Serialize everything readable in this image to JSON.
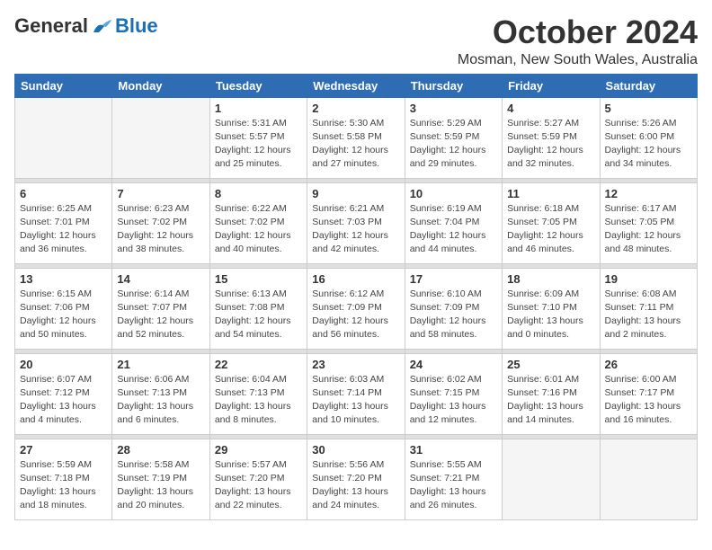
{
  "header": {
    "logo_general": "General",
    "logo_blue": "Blue",
    "month_title": "October 2024",
    "location": "Mosman, New South Wales, Australia"
  },
  "weekdays": [
    "Sunday",
    "Monday",
    "Tuesday",
    "Wednesday",
    "Thursday",
    "Friday",
    "Saturday"
  ],
  "weeks": [
    [
      {
        "day": "",
        "info": ""
      },
      {
        "day": "",
        "info": ""
      },
      {
        "day": "1",
        "info": "Sunrise: 5:31 AM\nSunset: 5:57 PM\nDaylight: 12 hours\nand 25 minutes."
      },
      {
        "day": "2",
        "info": "Sunrise: 5:30 AM\nSunset: 5:58 PM\nDaylight: 12 hours\nand 27 minutes."
      },
      {
        "day": "3",
        "info": "Sunrise: 5:29 AM\nSunset: 5:59 PM\nDaylight: 12 hours\nand 29 minutes."
      },
      {
        "day": "4",
        "info": "Sunrise: 5:27 AM\nSunset: 5:59 PM\nDaylight: 12 hours\nand 32 minutes."
      },
      {
        "day": "5",
        "info": "Sunrise: 5:26 AM\nSunset: 6:00 PM\nDaylight: 12 hours\nand 34 minutes."
      }
    ],
    [
      {
        "day": "6",
        "info": "Sunrise: 6:25 AM\nSunset: 7:01 PM\nDaylight: 12 hours\nand 36 minutes."
      },
      {
        "day": "7",
        "info": "Sunrise: 6:23 AM\nSunset: 7:02 PM\nDaylight: 12 hours\nand 38 minutes."
      },
      {
        "day": "8",
        "info": "Sunrise: 6:22 AM\nSunset: 7:02 PM\nDaylight: 12 hours\nand 40 minutes."
      },
      {
        "day": "9",
        "info": "Sunrise: 6:21 AM\nSunset: 7:03 PM\nDaylight: 12 hours\nand 42 minutes."
      },
      {
        "day": "10",
        "info": "Sunrise: 6:19 AM\nSunset: 7:04 PM\nDaylight: 12 hours\nand 44 minutes."
      },
      {
        "day": "11",
        "info": "Sunrise: 6:18 AM\nSunset: 7:05 PM\nDaylight: 12 hours\nand 46 minutes."
      },
      {
        "day": "12",
        "info": "Sunrise: 6:17 AM\nSunset: 7:05 PM\nDaylight: 12 hours\nand 48 minutes."
      }
    ],
    [
      {
        "day": "13",
        "info": "Sunrise: 6:15 AM\nSunset: 7:06 PM\nDaylight: 12 hours\nand 50 minutes."
      },
      {
        "day": "14",
        "info": "Sunrise: 6:14 AM\nSunset: 7:07 PM\nDaylight: 12 hours\nand 52 minutes."
      },
      {
        "day": "15",
        "info": "Sunrise: 6:13 AM\nSunset: 7:08 PM\nDaylight: 12 hours\nand 54 minutes."
      },
      {
        "day": "16",
        "info": "Sunrise: 6:12 AM\nSunset: 7:09 PM\nDaylight: 12 hours\nand 56 minutes."
      },
      {
        "day": "17",
        "info": "Sunrise: 6:10 AM\nSunset: 7:09 PM\nDaylight: 12 hours\nand 58 minutes."
      },
      {
        "day": "18",
        "info": "Sunrise: 6:09 AM\nSunset: 7:10 PM\nDaylight: 13 hours\nand 0 minutes."
      },
      {
        "day": "19",
        "info": "Sunrise: 6:08 AM\nSunset: 7:11 PM\nDaylight: 13 hours\nand 2 minutes."
      }
    ],
    [
      {
        "day": "20",
        "info": "Sunrise: 6:07 AM\nSunset: 7:12 PM\nDaylight: 13 hours\nand 4 minutes."
      },
      {
        "day": "21",
        "info": "Sunrise: 6:06 AM\nSunset: 7:13 PM\nDaylight: 13 hours\nand 6 minutes."
      },
      {
        "day": "22",
        "info": "Sunrise: 6:04 AM\nSunset: 7:13 PM\nDaylight: 13 hours\nand 8 minutes."
      },
      {
        "day": "23",
        "info": "Sunrise: 6:03 AM\nSunset: 7:14 PM\nDaylight: 13 hours\nand 10 minutes."
      },
      {
        "day": "24",
        "info": "Sunrise: 6:02 AM\nSunset: 7:15 PM\nDaylight: 13 hours\nand 12 minutes."
      },
      {
        "day": "25",
        "info": "Sunrise: 6:01 AM\nSunset: 7:16 PM\nDaylight: 13 hours\nand 14 minutes."
      },
      {
        "day": "26",
        "info": "Sunrise: 6:00 AM\nSunset: 7:17 PM\nDaylight: 13 hours\nand 16 minutes."
      }
    ],
    [
      {
        "day": "27",
        "info": "Sunrise: 5:59 AM\nSunset: 7:18 PM\nDaylight: 13 hours\nand 18 minutes."
      },
      {
        "day": "28",
        "info": "Sunrise: 5:58 AM\nSunset: 7:19 PM\nDaylight: 13 hours\nand 20 minutes."
      },
      {
        "day": "29",
        "info": "Sunrise: 5:57 AM\nSunset: 7:20 PM\nDaylight: 13 hours\nand 22 minutes."
      },
      {
        "day": "30",
        "info": "Sunrise: 5:56 AM\nSunset: 7:20 PM\nDaylight: 13 hours\nand 24 minutes."
      },
      {
        "day": "31",
        "info": "Sunrise: 5:55 AM\nSunset: 7:21 PM\nDaylight: 13 hours\nand 26 minutes."
      },
      {
        "day": "",
        "info": ""
      },
      {
        "day": "",
        "info": ""
      }
    ]
  ]
}
